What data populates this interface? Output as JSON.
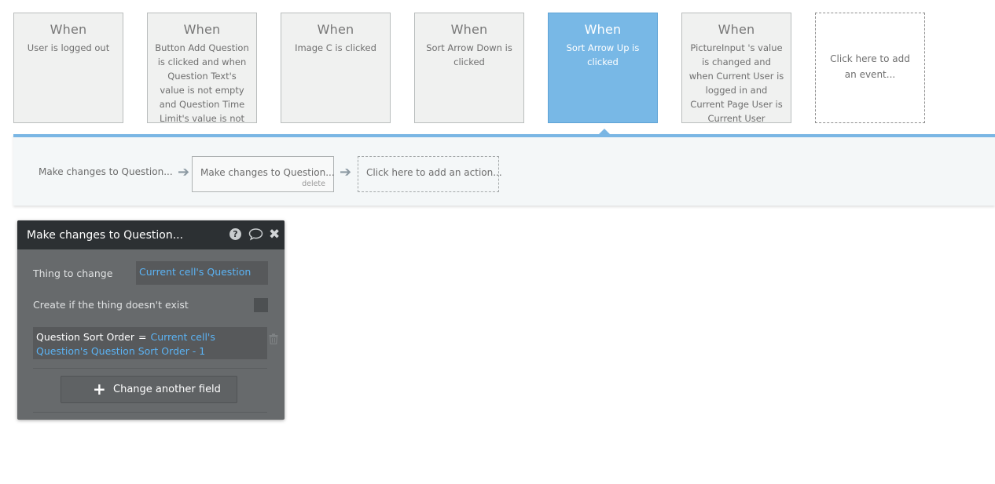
{
  "events": [
    {
      "when": "When",
      "description": "User is logged out",
      "active": false
    },
    {
      "when": "When",
      "description": "Button Add Question is clicked and when Question Text's value is not empty and Question Time Limit's value is not empty",
      "active": false
    },
    {
      "when": "When",
      "description": "Image C is clicked",
      "active": false
    },
    {
      "when": "When",
      "description": "Sort Arrow Down is clicked",
      "active": false
    },
    {
      "when": "When",
      "description": "Sort Arrow Up is clicked",
      "active": true
    },
    {
      "when": "When",
      "description": "PictureInput 's value is changed and when Current User is logged in and Current Page User is Current User",
      "active": false
    }
  ],
  "add_event_label": "Click here to add an event...",
  "actions": {
    "steps": [
      "Make changes to Question...",
      "Make changes to Question..."
    ],
    "delete_label": "delete",
    "add_action_label": "Click here to add an action..."
  },
  "panel": {
    "title": "Make changes to Question...",
    "thing_to_change_label": "Thing to change",
    "thing_to_change_value": "Current cell's Question",
    "create_if_missing_label": "Create if the thing doesn't exist",
    "create_if_missing_checked": false,
    "field_name": "Question Sort Order",
    "operator": "=",
    "expression": "Current cell's Question's Question Sort Order - 1",
    "change_another_field_label": "Change another field"
  },
  "colors": {
    "active_event": "#78b8e6",
    "accent": "#7ab6e4",
    "link_blue": "#5bb3f4",
    "panel_bg": "#676a6c",
    "panel_header": "#2c3033"
  },
  "icons": [
    "help-icon",
    "comment-icon",
    "close-icon",
    "arrow-right-icon",
    "trash-icon",
    "plus-icon"
  ]
}
